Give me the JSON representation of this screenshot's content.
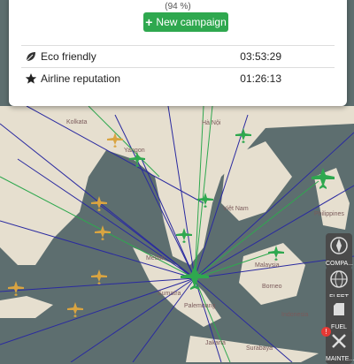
{
  "panel": {
    "percent_text": "(94 %)",
    "new_campaign_label": "New campaign",
    "rows": [
      {
        "label": "Eco friendly",
        "value": "03:53:29",
        "icon": "leaf-icon"
      },
      {
        "label": "Airline reputation",
        "value": "01:26:13",
        "icon": "star-icon"
      }
    ]
  },
  "map": {
    "labels": [
      "Kolkata",
      "Hà Nội",
      "Philippines",
      "Malaysia",
      "Borneo",
      "Indonesia",
      "Palembang",
      "Sumatra",
      "Jakarta",
      "Surabaya",
      "Medan",
      "Việt Nam",
      "Yangon"
    ]
  },
  "sidebar": {
    "items": [
      {
        "label": "COMPA...",
        "icon": "compass-icon"
      },
      {
        "label": "FLEET",
        "icon": "globe-icon"
      },
      {
        "label": "FUEL",
        "icon": "fuel-icon"
      },
      {
        "label": "MAINTE...",
        "icon": "wrench-icon",
        "badge": "!"
      }
    ]
  },
  "colors": {
    "accent": "#2fa84f",
    "sea": "#5d6e6f",
    "land": "#e8e2d2",
    "route_blue": "#2a2aa0",
    "route_green": "#2fa84f"
  }
}
